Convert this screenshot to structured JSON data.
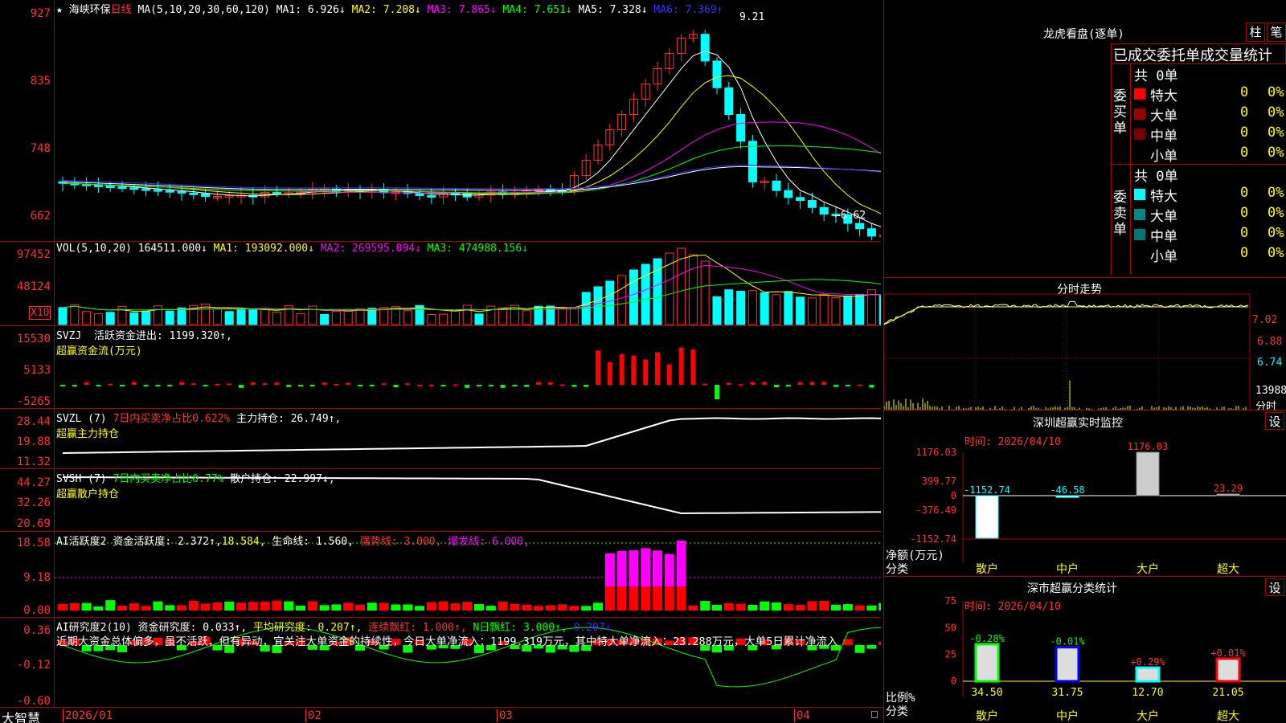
{
  "stock": {
    "star": "★",
    "name": "海峡环保",
    "period": "日线",
    "ma_def": "MA(5,10,20,30,60,120)",
    "ma": [
      {
        "label": "MA1:",
        "val": "6.926↓"
      },
      {
        "label": "MA2:",
        "val": "7.208↓"
      },
      {
        "label": "MA3:",
        "val": "7.865↓"
      },
      {
        "label": "MA4:",
        "val": "7.651↓"
      },
      {
        "label": "MA5:",
        "val": "7.328↓"
      },
      {
        "label": "MA6:",
        "val": "7.369↑"
      }
    ],
    "high": "9.21",
    "low": "←6.62",
    "ylabels": [
      "927",
      "835",
      "748",
      "662"
    ]
  },
  "vol": {
    "label": "VOL(5,10,20)",
    "val": "164511.000↓",
    "ma1": "MA1: 193092.000↓",
    "ma2": "MA2: 269595.094↓",
    "ma3": "MA3: 474988.156↓",
    "ylabels": [
      "97452",
      "48124"
    ],
    "unit": "X10"
  },
  "svzj": {
    "label": "SVZJ",
    "desc": "活跃资金进出: 1199.320↑,",
    "title": "超赢资金流(万元)",
    "ylabels": [
      "15530",
      "5133",
      "-5265"
    ]
  },
  "svzl": {
    "label": "SVZL (7)",
    "desc1": "7日内买卖净占比0.622%",
    "desc2": "主力持仓: 26.749↑,",
    "title": "超赢主力持仓",
    "ylabels": [
      "28.44",
      "19.88",
      "11.32"
    ]
  },
  "svsh": {
    "label": "SVSH (7)",
    "desc1": "7日内买卖净占比0.77%",
    "desc2": "散户持仓: 22.997↓,",
    "title": "超赢散户持仓",
    "ylabels": [
      "44.27",
      "32.26",
      "20.69"
    ]
  },
  "ai2": {
    "p1": "AI活跃度2",
    "p2": "资金活跃度: 2.372↑,",
    "p3": "18.584,",
    "p4": "生命线: 1.560,",
    "p5": "强势线: 3.000,",
    "p6": "爆发线: 6.000,",
    "ylabels": [
      "18.58",
      "9.18",
      "0.00"
    ]
  },
  "ai3": {
    "p1": "AI研究度2(10)",
    "p2": "资金研究度: 0.033↑,",
    "p3": "平均研究度: 0.207↑,",
    "p4": "连续飘红: 1.000↑,",
    "p5": "N日飘红: 3.000↑,",
    "p6": "0.207↓",
    "note": "近期大资金总体偏多，虽不活跃，但有异动，宜关注大单资金的持续性，今日大单净流入：1199.319万元，其中特大单净流入：23.288万元，大单5日累计净流入",
    "ylabels": [
      "0.36",
      "-0.12",
      "-0.60"
    ]
  },
  "bottom": {
    "brand": "大智慧",
    "dates": [
      "2026/01",
      "02",
      "03",
      "04"
    ]
  },
  "lhb": {
    "title": "龙虎看盘(逐单)",
    "btn1": "柱",
    "btn2": "笔",
    "subtitle": "已成交委托单成交量统计",
    "buy": {
      "side": "委买单",
      "total": "共 0单",
      "rows": [
        {
          "name": "特大",
          "v": "0",
          "p": "0%"
        },
        {
          "name": "大单",
          "v": "0",
          "p": "0%"
        },
        {
          "name": "中单",
          "v": "0",
          "p": "0%"
        },
        {
          "name": "小单",
          "v": "0",
          "p": "0%"
        }
      ]
    },
    "sell": {
      "side": "委卖单",
      "total": "共 0单",
      "rows": [
        {
          "name": "特大",
          "v": "0",
          "p": "0%"
        },
        {
          "name": "大单",
          "v": "0",
          "p": "0%"
        },
        {
          "name": "中单",
          "v": "0",
          "p": "0%"
        },
        {
          "name": "小单",
          "v": "0",
          "p": "0%"
        }
      ]
    }
  },
  "fenshi": {
    "title": "分时走势",
    "ylabels": [
      "7.02",
      "6.88",
      "6.74"
    ],
    "vol": "13988",
    "unit": "分时"
  },
  "monitor": {
    "title": "深圳超赢实时监控",
    "btn": "设",
    "time": "时间: 2026/04/10",
    "ylabels": [
      "1176.03",
      "399.77",
      "0",
      "-376.49",
      "-1152.74"
    ],
    "net": "净额(万元)",
    "cls": "分类",
    "cats": [
      "散户",
      "中户",
      "大户",
      "超大"
    ],
    "vals": [
      "-1152.74",
      "-46.58",
      "1176.03",
      "23.29"
    ]
  },
  "stats": {
    "title": "深市超赢分类统计",
    "btn": "设",
    "time": "时间: 2026/04/10",
    "ylabels": [
      "75",
      "50",
      "25",
      "0"
    ],
    "ratio": "比例%",
    "cls": "分类",
    "cats": [
      "散户",
      "中户",
      "大户",
      "超大"
    ],
    "vals": [
      "34.50",
      "31.75",
      "12.70",
      "21.05"
    ],
    "chg": [
      "-0.28%",
      "-0.01%",
      "+0.29%",
      "+0.01%"
    ]
  }
}
